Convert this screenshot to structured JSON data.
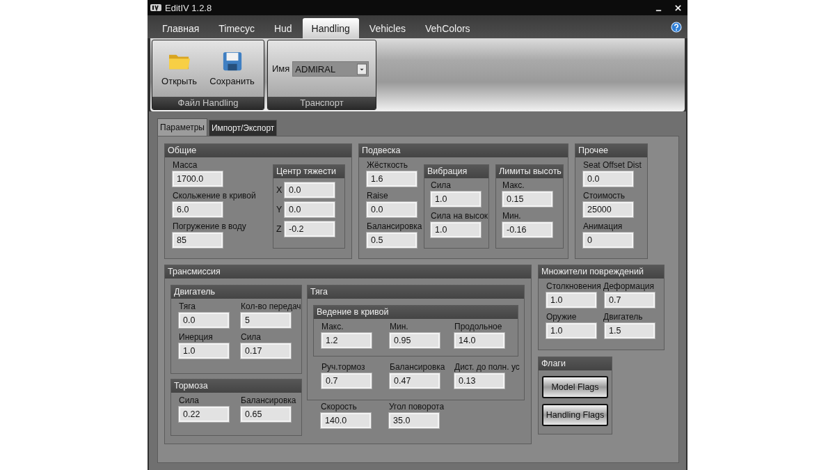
{
  "window": {
    "title": "EditIV 1.2.8"
  },
  "tabs": [
    {
      "label": "Главная",
      "selected": false
    },
    {
      "label": "Timecyc",
      "selected": false
    },
    {
      "label": "Hud",
      "selected": false
    },
    {
      "label": "Handling",
      "selected": true
    },
    {
      "label": "Vehicles",
      "selected": false
    },
    {
      "label": "VehColors",
      "selected": false
    }
  ],
  "ribbon": {
    "file_group": {
      "title": "Файл Handling",
      "buttons": [
        {
          "label": "Открыть",
          "kind": "open"
        },
        {
          "label": "Сохранить",
          "kind": "save"
        }
      ]
    },
    "vehicle_group": {
      "title": "Транспорт",
      "name_label": "Имя",
      "name_value": "ADMIRAL"
    }
  },
  "sub_tabs": [
    {
      "label": "Параметры",
      "selected": true
    },
    {
      "label": "Импорт/Экспорт",
      "selected": false
    }
  ],
  "general": {
    "title": "Общие",
    "fields": [
      {
        "label": "Масса",
        "value": "1700.0"
      },
      {
        "label": "Скольжение в кривой",
        "value": "6.0"
      },
      {
        "label": "Погружение в воду",
        "value": "85"
      }
    ],
    "center_of_mass": {
      "title": "Центр тяжести",
      "fields": [
        {
          "label": "X",
          "value": "0.0"
        },
        {
          "label": "Y",
          "value": "0.0"
        },
        {
          "label": "Z",
          "value": "-0.2"
        }
      ]
    }
  },
  "suspension": {
    "title": "Подвеска",
    "fields": [
      {
        "label": "Жёсткость",
        "value": "1.6"
      },
      {
        "label": "Raise",
        "value": "0.0"
      },
      {
        "label": "Балансировка",
        "value": "0.5"
      }
    ],
    "vibration": {
      "title": "Вибрация",
      "fields": [
        {
          "label": "Сила",
          "value": "1.0"
        },
        {
          "label": "Сила на высок",
          "value": "1.0"
        }
      ]
    },
    "height_limits": {
      "title": "Лимиты высоть",
      "fields": [
        {
          "label": "Макс.",
          "value": "0.15"
        },
        {
          "label": "Мин.",
          "value": "-0.16"
        }
      ]
    }
  },
  "misc": {
    "title": "Прочее",
    "fields": [
      {
        "label": "Seat Offset Dist",
        "value": "0.0"
      },
      {
        "label": "Стоимость",
        "value": "25000"
      },
      {
        "label": "Анимация",
        "value": "0"
      }
    ]
  },
  "transmission": {
    "title": "Трансмиссия",
    "engine": {
      "title": "Двигатель",
      "fields": [
        {
          "label": "Тяга",
          "value": "0.0"
        },
        {
          "label": "Кол-во передач",
          "value": "5"
        },
        {
          "label": "Инерция",
          "value": "1.0"
        },
        {
          "label": "Сила",
          "value": "0.17"
        }
      ]
    },
    "brakes": {
      "title": "Тормоза",
      "fields": [
        {
          "label": "Сила",
          "value": "0.22"
        },
        {
          "label": "Балансировка",
          "value": "0.65"
        }
      ]
    },
    "traction": {
      "title": "Тяга",
      "cornering": {
        "title": "Ведение в кривой",
        "fields": [
          {
            "label": "Макс.",
            "value": "1.2"
          },
          {
            "label": "Мин.",
            "value": "0.95"
          },
          {
            "label": "Продольное",
            "value": "14.0"
          }
        ]
      },
      "fields": [
        {
          "label": "Руч.тормоз",
          "value": "0.7"
        },
        {
          "label": "Балансировка",
          "value": "0.47"
        },
        {
          "label": "Дист. до полн. ус",
          "value": "0.13"
        }
      ]
    },
    "fields": [
      {
        "label": "Скорость",
        "value": "140.0"
      },
      {
        "label": "Угол поворота",
        "value": "35.0"
      }
    ]
  },
  "damage": {
    "title": "Множители повреждений",
    "fields": [
      {
        "label": "Столкновения",
        "value": "1.0"
      },
      {
        "label": "Деформация",
        "value": "0.7"
      },
      {
        "label": "Оружие",
        "value": "1.0"
      },
      {
        "label": "Двигатель",
        "value": "1.5"
      }
    ]
  },
  "flags": {
    "title": "Флаги",
    "buttons": [
      "Model Flags",
      "Handling Flags"
    ]
  }
}
